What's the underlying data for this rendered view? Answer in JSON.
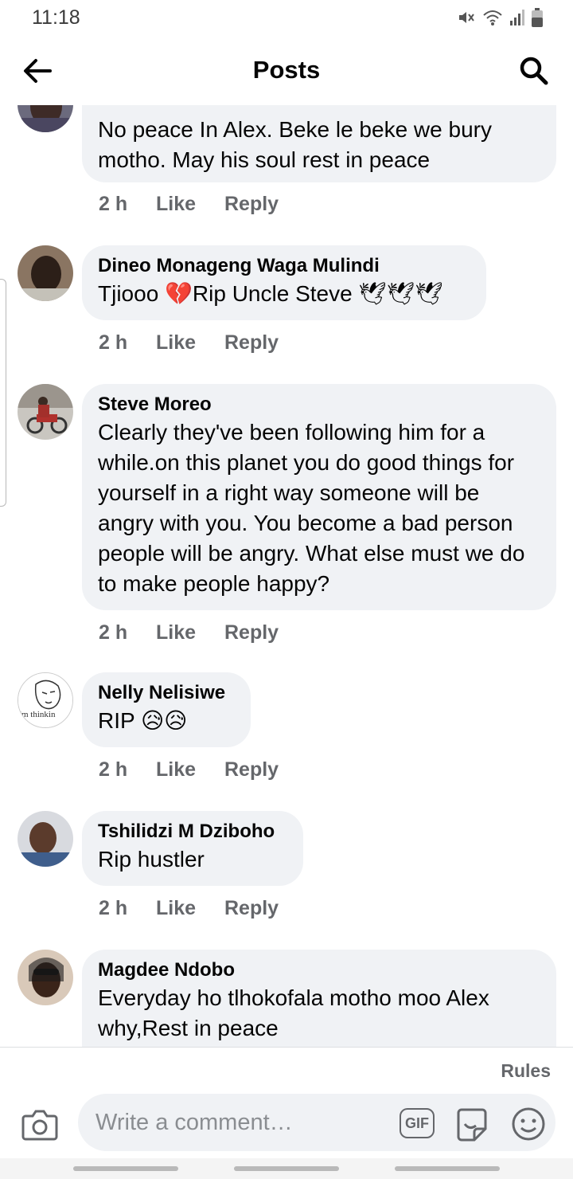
{
  "status_bar": {
    "time": "11:18"
  },
  "header": {
    "title": "Posts"
  },
  "comments": [
    {
      "author": "",
      "text": "No peace In Alex. Beke le beke we bury motho. May his soul rest in peace",
      "time": "2 h",
      "like": "Like",
      "reply": "Reply"
    },
    {
      "author": "Dineo Monageng Waga Mulindi",
      "text": "Tjiooo 💔Rip Uncle Steve 🕊🕊🕊",
      "time": "2 h",
      "like": "Like",
      "reply": "Reply"
    },
    {
      "author": "Steve Moreo",
      "text": "Clearly they've been following him for a while.on this planet you do good things for yourself in a right way someone will be angry with you. You become a bad person people will be angry. What else must we do to make people happy?",
      "time": "2 h",
      "like": "Like",
      "reply": "Reply"
    },
    {
      "author": "Nelly Nelisiwe",
      "text": "RIP 😥😥",
      "avatar_caption": "'m thinkin",
      "time": "2 h",
      "like": "Like",
      "reply": "Reply"
    },
    {
      "author": "Tshilidzi M Dziboho",
      "text": "Rip hustler",
      "time": "2 h",
      "like": "Like",
      "reply": "Reply"
    },
    {
      "author": "Magdee Ndobo",
      "text": "Everyday ho tlhokofala motho moo Alex why,Rest in peace"
    }
  ],
  "composer": {
    "rules": "Rules",
    "placeholder": "Write a comment…",
    "gif_label": "GIF"
  },
  "icons": {
    "back": "back-arrow-icon",
    "search": "search-icon",
    "camera": "camera-icon",
    "sticker": "sticker-icon",
    "emoji": "emoji-icon",
    "mute": "mute-icon",
    "wifi": "wifi-icon",
    "signal": "signal-icon",
    "battery": "battery-icon"
  },
  "colors": {
    "bubble": "#f0f2f5",
    "secondary_text": "#65676b",
    "primary_text": "#050505"
  }
}
